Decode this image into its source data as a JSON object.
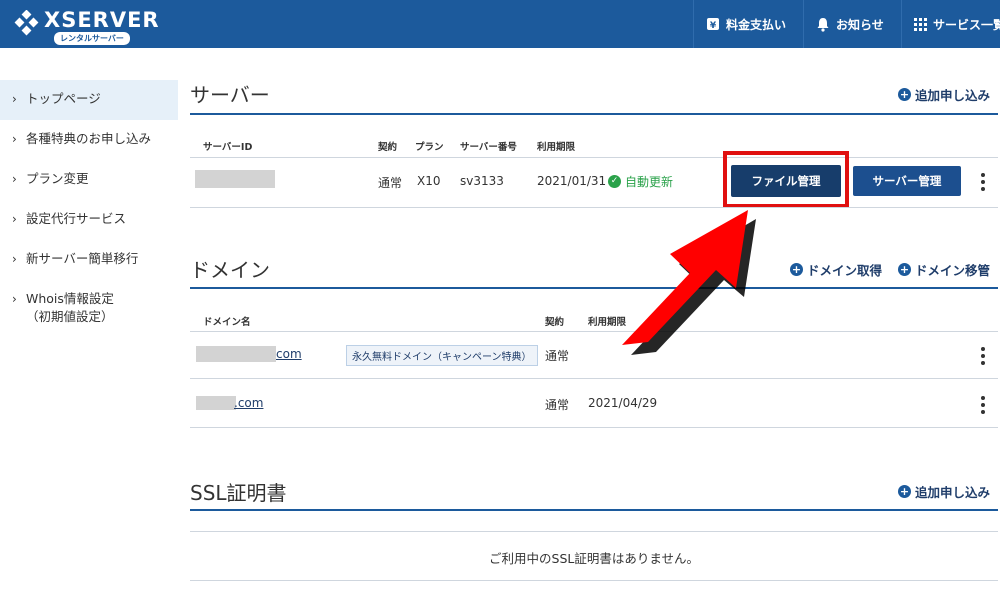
{
  "header": {
    "logo_text": "XSERVER",
    "logo_sub": "レンタルサーバー",
    "nav": {
      "fee": "料金支払い",
      "notice": "お知らせ",
      "services": "サービス一覧"
    }
  },
  "sidebar": {
    "items": [
      {
        "label": "トップページ"
      },
      {
        "label": "各種特典のお申し込み"
      },
      {
        "label": "プラン変更"
      },
      {
        "label": "設定代行サービス"
      },
      {
        "label": "新サーバー簡単移行"
      },
      {
        "label": "Whois情報設定\n（初期値設定）"
      }
    ]
  },
  "server": {
    "title": "サーバー",
    "add_label": "追加申し込み",
    "headers": {
      "id": "サーバーID",
      "contract": "契約",
      "plan": "プラン",
      "number": "サーバー番号",
      "period": "利用期限"
    },
    "row": {
      "contract": "通常",
      "plan": "X10",
      "number": "sv3133",
      "period": "2021/01/31",
      "auto_renew": "自動更新"
    },
    "file_button": "ファイル管理",
    "server_button": "サーバー管理"
  },
  "domain": {
    "title": "ドメイン",
    "acquire_label": "ドメイン取得",
    "transfer_label": "ドメイン移管",
    "headers": {
      "name": "ドメイン名",
      "contract": "契約",
      "period": "利用期限"
    },
    "rows": [
      {
        "name": "com",
        "tag": "永久無料ドメイン（キャンペーン特典）",
        "contract": "通常",
        "period": ""
      },
      {
        "name": ".com",
        "tag": "",
        "contract": "通常",
        "period": "2021/04/29"
      }
    ]
  },
  "ssl": {
    "title": "SSL証明書",
    "add_label": "追加申し込み",
    "empty": "ご利用中のSSL証明書はありません。"
  },
  "colors": {
    "header": "#1c5a9c",
    "highlight": "#e01010",
    "arrow": "#ff0000",
    "renew": "#2aa24a"
  }
}
